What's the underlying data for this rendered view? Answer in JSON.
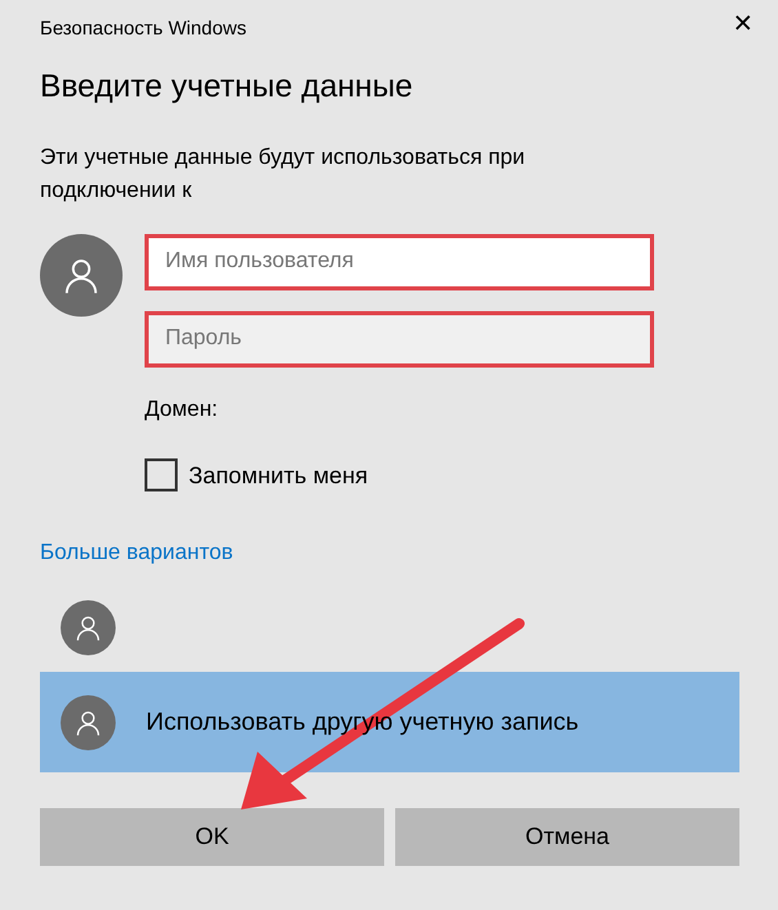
{
  "window": {
    "title": "Безопасность Windows",
    "close": "✕"
  },
  "heading": "Введите учетные данные",
  "description": "Эти учетные данные будут использоваться при подключении к",
  "fields": [
    {
      "placeholder": "Имя пользователя",
      "focused": true,
      "highlighted": true
    },
    {
      "placeholder": "Пароль",
      "focused": false,
      "highlighted": true
    }
  ],
  "domain_label": "Домен:",
  "remember": {
    "label": "Запомнить меня",
    "checked": false
  },
  "more_link": "Больше вариантов",
  "accounts": [
    {
      "selected": false
    },
    {
      "label": "Использовать другую учетную запись",
      "selected": true
    }
  ],
  "buttons": [
    "OK",
    "Отмена"
  ],
  "annotation": {
    "kind": "arrow"
  }
}
